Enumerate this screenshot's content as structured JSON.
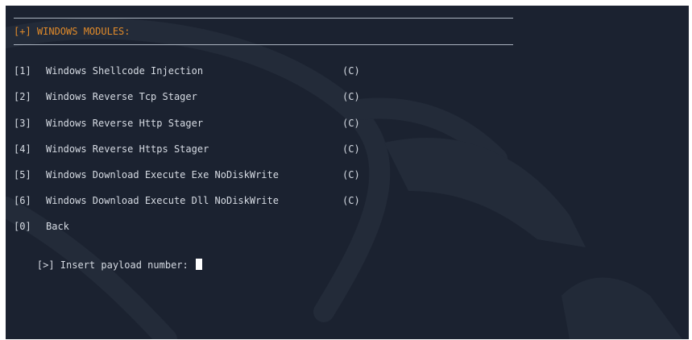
{
  "terminal": {
    "header": "[+] WINDOWS MODULES:",
    "items": [
      {
        "num": "[1]",
        "label": "Windows Shellcode Injection",
        "tag": "(C)"
      },
      {
        "num": "[2]",
        "label": "Windows Reverse Tcp Stager",
        "tag": "(C)"
      },
      {
        "num": "[3]",
        "label": "Windows Reverse Http Stager",
        "tag": "(C)"
      },
      {
        "num": "[4]",
        "label": "Windows Reverse Https Stager",
        "tag": "(C)"
      },
      {
        "num": "[5]",
        "label": "Windows Download Execute Exe NoDiskWrite",
        "tag": "(C)"
      },
      {
        "num": "[6]",
        "label": "Windows Download Execute Dll NoDiskWrite",
        "tag": "(C)"
      },
      {
        "num": "[0]",
        "label": "Back",
        "tag": ""
      }
    ],
    "prompt": "[>] Insert payload number: "
  },
  "colors": {
    "background": "#1b2230",
    "text": "#d6dbe3",
    "header": "#e08a2a",
    "rule": "#aab3bf",
    "cursor": "#ffffff"
  },
  "icons": {
    "background_watermark": "kali-dragon-icon"
  }
}
